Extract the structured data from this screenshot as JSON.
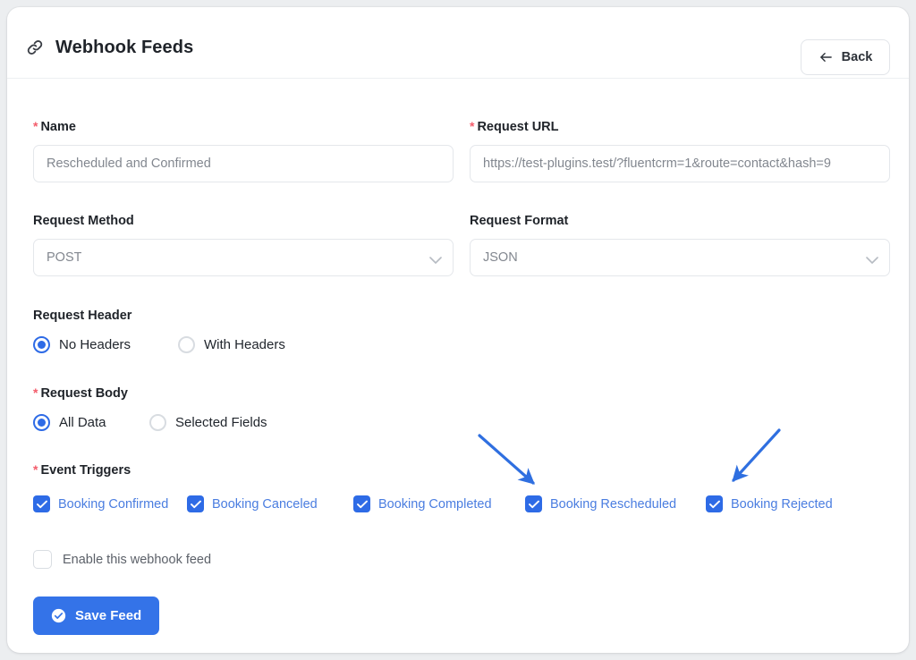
{
  "header": {
    "title": "Webhook Feeds",
    "icon": "link-icon",
    "back_label": "Back",
    "back_icon": "arrow-left-icon"
  },
  "form": {
    "name": {
      "label": "Name",
      "required_marker": "*",
      "value": "Rescheduled and Confirmed"
    },
    "request_url": {
      "label": "Request URL",
      "required_marker": "*",
      "value": "https://test-plugins.test/?fluentcrm=1&route=contact&hash=9"
    },
    "request_method": {
      "label": "Request Method",
      "value": "POST",
      "chevron_icon": "chevron-down-icon"
    },
    "request_format": {
      "label": "Request Format",
      "value": "JSON",
      "chevron_icon": "chevron-down-icon"
    },
    "request_header": {
      "label": "Request Header",
      "options": [
        {
          "label": "No Headers",
          "selected": true
        },
        {
          "label": "With Headers",
          "selected": false
        }
      ]
    },
    "request_body": {
      "label": "Request Body",
      "required_marker": "*",
      "options": [
        {
          "label": "All Data",
          "selected": true
        },
        {
          "label": "Selected Fields",
          "selected": false
        }
      ]
    },
    "event_triggers": {
      "label": "Event Triggers",
      "required_marker": "*",
      "items": [
        {
          "label": "Booking Confirmed",
          "checked": true
        },
        {
          "label": "Booking Canceled",
          "checked": true
        },
        {
          "label": "Booking Completed",
          "checked": true
        },
        {
          "label": "Booking Rescheduled",
          "checked": true
        },
        {
          "label": "Booking Rejected",
          "checked": true
        }
      ]
    },
    "enable_feed": {
      "label": "Enable this webhook feed",
      "checked": false
    }
  },
  "actions": {
    "save_label": "Save Feed",
    "save_icon": "check-circle-icon"
  },
  "annotations": [
    {
      "name": "arrow-to-booking-rescheduled",
      "color": "#2f6fe0"
    },
    {
      "name": "arrow-to-booking-rejected",
      "color": "#2f6fe0"
    }
  ],
  "colors": {
    "accent": "#2e6be6",
    "save_button": "#3473e8",
    "required": "#f35c6b",
    "trigger_label": "#4a7de0",
    "page_bg": "#eceef0"
  }
}
